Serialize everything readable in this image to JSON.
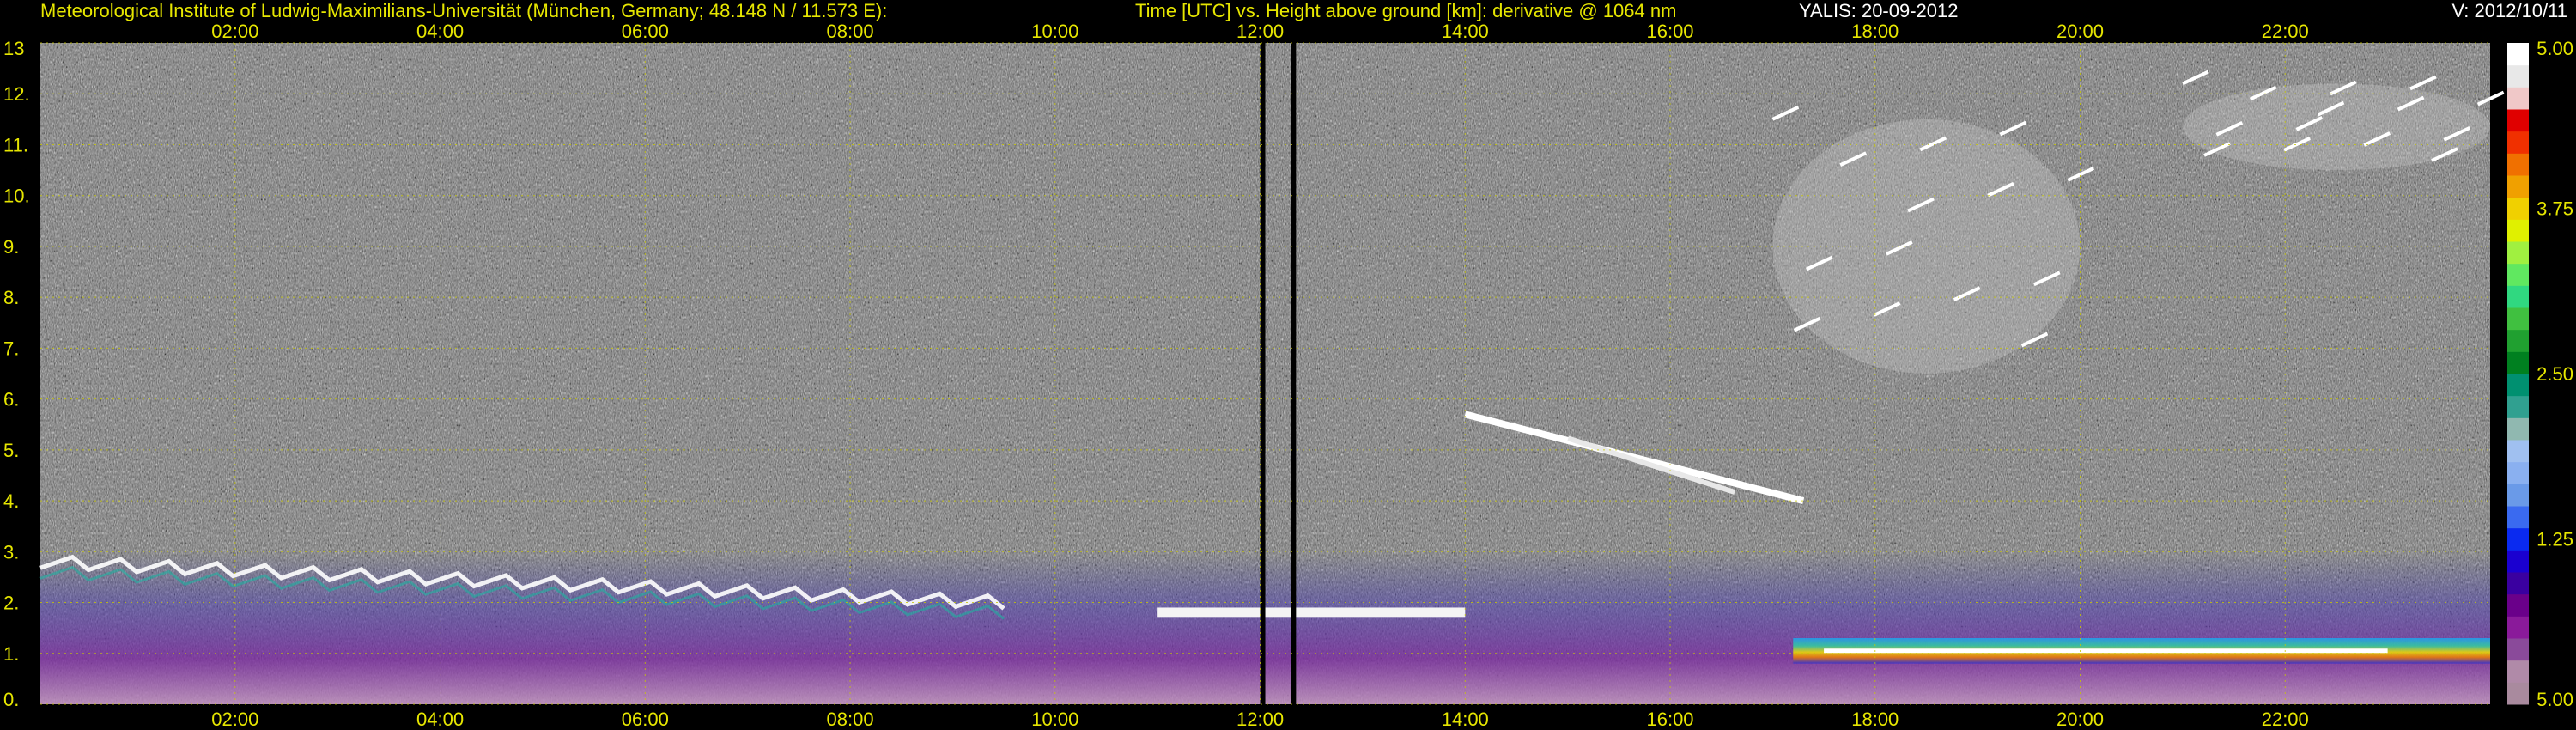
{
  "header": {
    "institute": "Meteorological Institute of Ludwig-Maximilians-Universität (München, Germany; 48.148 N / 11.573 E):",
    "title": "Time [UTC] vs. Height above ground [km]: derivative @ 1064 nm",
    "instrument": "YALIS: 20-09-2012",
    "version": "V: 2012/10/11"
  },
  "chart_data": {
    "type": "heatmap",
    "title": "Time [UTC] vs. Height above ground [km]: derivative @ 1064 nm",
    "xlabel": "Time [UTC]",
    "ylabel": "Height above ground [km]",
    "x_unit": "hours UTC",
    "xlim": [
      0.1,
      24.0
    ],
    "ylim": [
      0,
      13
    ],
    "x_ticks": [
      {
        "value": 2,
        "label": "02:00"
      },
      {
        "value": 4,
        "label": "04:00"
      },
      {
        "value": 6,
        "label": "06:00"
      },
      {
        "value": 8,
        "label": "08:00"
      },
      {
        "value": 10,
        "label": "10:00"
      },
      {
        "value": 12,
        "label": "12:00"
      },
      {
        "value": 14,
        "label": "14:00"
      },
      {
        "value": 16,
        "label": "16:00"
      },
      {
        "value": 18,
        "label": "18:00"
      },
      {
        "value": 20,
        "label": "20:00"
      },
      {
        "value": 22,
        "label": "22:00"
      }
    ],
    "y_ticks": [
      {
        "value": 0,
        "label": "0."
      },
      {
        "value": 1,
        "label": "1."
      },
      {
        "value": 2,
        "label": "2."
      },
      {
        "value": 3,
        "label": "3."
      },
      {
        "value": 4,
        "label": "4."
      },
      {
        "value": 5,
        "label": "5."
      },
      {
        "value": 6,
        "label": "6."
      },
      {
        "value": 7,
        "label": "7."
      },
      {
        "value": 8,
        "label": "8."
      },
      {
        "value": 9,
        "label": "9."
      },
      {
        "value": 10,
        "label": "10."
      },
      {
        "value": 11,
        "label": "11."
      },
      {
        "value": 12,
        "label": "12."
      },
      {
        "value": 13,
        "label": "13"
      }
    ],
    "grid": true,
    "background_color": "#7a7a7a",
    "grid_color": "#c8c800",
    "colorbar": {
      "ticks": [
        {
          "value": "5.00",
          "level": 1.0
        },
        {
          "value": "3.75",
          "level": 0.75
        },
        {
          "value": "2.50",
          "level": 0.5
        },
        {
          "value": "1.25",
          "level": 0.25
        },
        {
          "value": "5.00",
          "level": 0.0
        }
      ],
      "colors": [
        "#a98a9e",
        "#b08aa8",
        "#8a4a9a",
        "#8a1a9a",
        "#6a008a",
        "#3a00a0",
        "#1a00d0",
        "#0a2af0",
        "#3a6af0",
        "#6a9ae8",
        "#8ab0f0",
        "#a0c0f0",
        "#90b8b0",
        "#30a090",
        "#009070",
        "#008020",
        "#20a030",
        "#40c040",
        "#30d880",
        "#60e860",
        "#a0f040",
        "#e0f000",
        "#f0d000",
        "#f0a000",
        "#f07000",
        "#f03000",
        "#e00000",
        "#f0c8c8",
        "#e8e8e8",
        "#ffffff"
      ]
    },
    "features": [
      {
        "name": "boundary layer aerosol",
        "x": [
          0.1,
          24.0
        ],
        "y": [
          0.0,
          3.0
        ]
      },
      {
        "name": "aerosol layer top",
        "x": [
          0.1,
          9.5
        ],
        "y": [
          2.0,
          2.8
        ]
      },
      {
        "name": "cloud layer",
        "x": [
          11.0,
          14.0
        ],
        "y": [
          1.7,
          1.9
        ]
      },
      {
        "name": "cloud layer",
        "x": [
          14.0,
          17.3
        ],
        "y": [
          4.0,
          5.7
        ]
      },
      {
        "name": "cirrus",
        "x": [
          17.0,
          20.0
        ],
        "y": [
          6.5,
          11.5
        ]
      },
      {
        "name": "cirrus",
        "x": [
          21.0,
          24.0
        ],
        "y": [
          10.5,
          12.2
        ]
      },
      {
        "name": "strong backscatter layer",
        "x": [
          17.2,
          24.0
        ],
        "y": [
          0.8,
          1.3
        ]
      },
      {
        "name": "data gap",
        "x": [
          12.0,
          12.05
        ],
        "y": [
          0,
          13
        ]
      },
      {
        "name": "data gap",
        "x": [
          12.3,
          12.35
        ],
        "y": [
          0,
          13
        ]
      }
    ]
  }
}
